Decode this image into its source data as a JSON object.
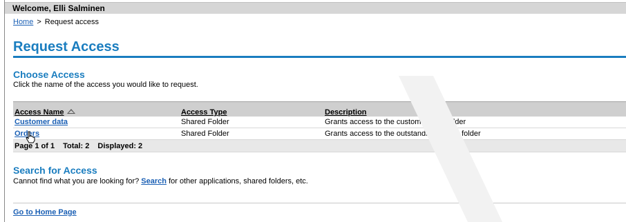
{
  "header": {
    "welcome": "Welcome, Elli Salminen"
  },
  "breadcrumb": {
    "home": "Home",
    "separator": ">",
    "current": "Request access"
  },
  "page_title": "Request Access",
  "choose_access": {
    "title": "Choose Access",
    "description": "Click the name of the access you would like to request."
  },
  "table": {
    "columns": [
      "Access Name",
      "Access Type",
      "Description"
    ],
    "sort_icon": "sort-ascending-icon",
    "rows": [
      {
        "name": "Customer data",
        "type": "Shared Folder",
        "description": "Grants access to the customer data folder"
      },
      {
        "name": "Orders",
        "type": "Shared Folder",
        "description": "Grants access to the outstanding orders folder"
      }
    ],
    "pager": {
      "page": "Page 1 of 1",
      "total": "Total: 2",
      "displayed": "Displayed: 2"
    }
  },
  "search_access": {
    "title": "Search for Access",
    "before": "Cannot find what you are looking for?",
    "link": "Search",
    "after": "for other applications, shared folders, etc."
  },
  "footer": {
    "home_link": "Go to Home Page"
  },
  "colors": {
    "accent": "#1a7dbf",
    "link": "#1a5fb4",
    "header_bg": "#d6d6d6"
  }
}
